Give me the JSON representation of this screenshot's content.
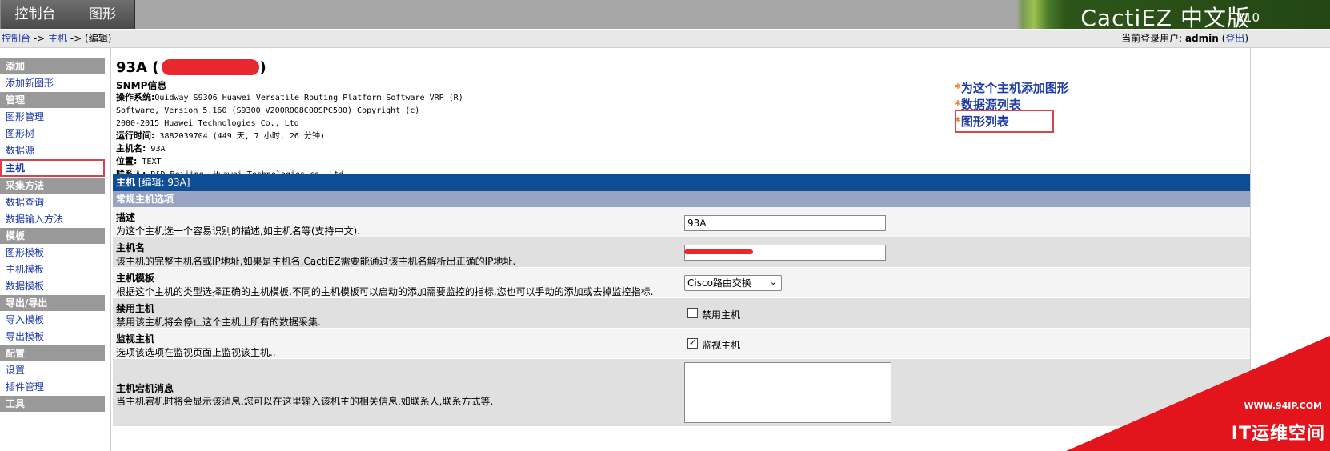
{
  "topbar": {
    "tabs": [
      {
        "label": "控制台"
      },
      {
        "label": "图形"
      }
    ],
    "brand_title": "CactiEZ 中文版",
    "brand_version": "V10"
  },
  "breadcrumb": {
    "console": "控制台",
    "sep1": " -> ",
    "host": "主机",
    "sep2": " -> (编辑)",
    "user_prefix": "当前登录用户: ",
    "user": "admin",
    "logout_open": " (",
    "logout": "登出",
    "logout_close": ")"
  },
  "sidebar": [
    {
      "type": "head",
      "label": "添加"
    },
    {
      "type": "item",
      "label": "添加新图形"
    },
    {
      "type": "head",
      "label": "管理"
    },
    {
      "type": "item",
      "label": "图形管理"
    },
    {
      "type": "item",
      "label": "图形树"
    },
    {
      "type": "item",
      "label": "数据源"
    },
    {
      "type": "item",
      "label": "主机",
      "selected": true
    },
    {
      "type": "head",
      "label": "采集方法"
    },
    {
      "type": "item",
      "label": "数据查询"
    },
    {
      "type": "item",
      "label": "数据输入方法"
    },
    {
      "type": "head",
      "label": "模板"
    },
    {
      "type": "item",
      "label": "图形模板"
    },
    {
      "type": "item",
      "label": "主机模板"
    },
    {
      "type": "item",
      "label": "数据模板"
    },
    {
      "type": "head",
      "label": "导出/导出"
    },
    {
      "type": "item",
      "label": "导入模板"
    },
    {
      "type": "item",
      "label": "导出模板"
    },
    {
      "type": "head",
      "label": "配置"
    },
    {
      "type": "item",
      "label": "设置"
    },
    {
      "type": "item",
      "label": "插件管理"
    },
    {
      "type": "head",
      "label": "工具"
    }
  ],
  "host": {
    "title_prefix": "93A (",
    "title_suffix": ")",
    "snmp_label": "SNMP信息",
    "os_label": "操作系统:",
    "os_line1": "Quidway S9306 Huawei Versatile Routing Platform Software VRP (R)",
    "os_line2": "Software, Version 5.160 (S9300 V200R008C00SPC500) Copyright (c)",
    "os_line3": "2000-2015 Huawei Technologies Co., Ltd",
    "uptime_label": "运行时间:",
    "uptime_value": " 3882039704  (449 天, 7 小时, 26 分钟)",
    "hostname_label": "主机名:",
    "hostname_value": " 93A",
    "location_label": "位置:",
    "location_value": " TEXT",
    "contact_label": "联系人:",
    "contact_value": " R&D Beijing, Huawei Technologies co.,Ltd."
  },
  "actions": [
    {
      "star": "*",
      "label": "为这个主机添加图形"
    },
    {
      "star": "*",
      "label": "数据源列表"
    },
    {
      "star": "*",
      "label": "图形列表"
    }
  ],
  "form": {
    "header_bold": "主机",
    "header_rest": " [编辑: 93A]",
    "section": "常规主机选项",
    "description": {
      "label": "描述",
      "desc": "为这个主机选一个容易识别的描述,如主机名等(支持中文).",
      "value": "93A"
    },
    "hostname": {
      "label": "主机名",
      "desc": "该主机的完整主机名或IP地址,如果是主机名,CactiEZ需要能通过该主机名解析出正确的IP地址."
    },
    "template": {
      "label": "主机模板",
      "desc": "根据这个主机的类型选择正确的主机模板,不同的主机模板可以启动的添加需要监控的指标,您也可以手动的添加或去掉监控指标.",
      "selected": "Cisco路由交换"
    },
    "disable": {
      "label": "禁用主机",
      "desc": "禁用该主机将会停止这个主机上所有的数据采集.",
      "checkbox_label": "禁用主机",
      "checked": false
    },
    "monitor": {
      "label": "监视主机",
      "desc": "选项该选项在监视页面上监视该主机..",
      "checkbox_label": "监视主机",
      "checked": true
    },
    "notes": {
      "label": "主机宕机消息",
      "desc": "当主机宕机时将会显示该消息,您可以在这里输入该机主的相关信息,如联系人,联系方式等."
    }
  },
  "watermark": {
    "url": "WWW.94IP.COM",
    "text": "IT运维空间"
  },
  "colors": {
    "header_blue": "#0f4d94",
    "section_blue": "#98a4c2",
    "link_blue": "#1d3ba8",
    "star_orange": "#e07a25",
    "highlight_red": "#d9424a"
  }
}
